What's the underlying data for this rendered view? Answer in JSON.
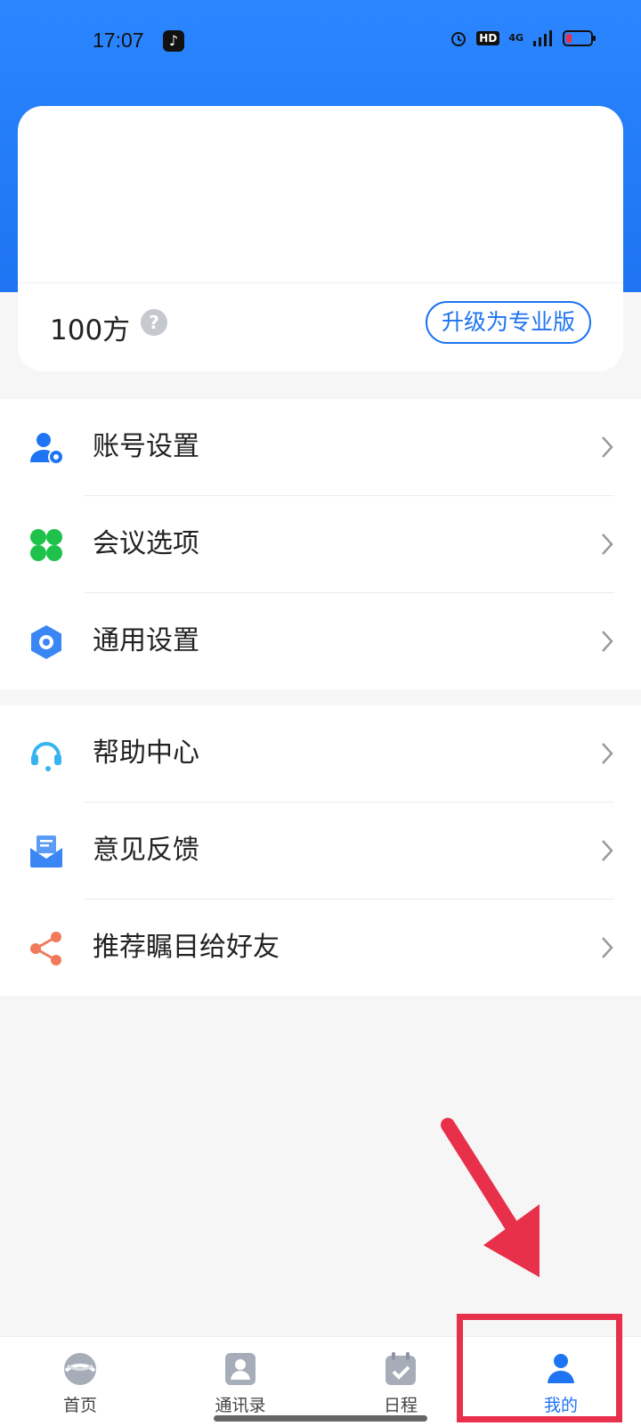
{
  "status": {
    "time": "17:07",
    "hd": "HD",
    "network": "4G"
  },
  "account": {
    "quota": "100方",
    "help_symbol": "?",
    "upgrade_label": "升级为专业版"
  },
  "menu": {
    "group1": [
      {
        "label": "账号设置",
        "icon": "user-gear-icon"
      },
      {
        "label": "会议选项",
        "icon": "clover-icon"
      },
      {
        "label": "通用设置",
        "icon": "hexagon-settings-icon"
      }
    ],
    "group2": [
      {
        "label": "帮助中心",
        "icon": "headset-icon"
      },
      {
        "label": "意见反馈",
        "icon": "mail-feedback-icon"
      },
      {
        "label": "推荐瞩目给好友",
        "icon": "share-icon"
      }
    ]
  },
  "tabs": [
    {
      "label": "首页",
      "icon": "home-swirl-icon",
      "active": false
    },
    {
      "label": "通讯录",
      "icon": "contacts-icon",
      "active": false
    },
    {
      "label": "日程",
      "icon": "calendar-check-icon",
      "active": false
    },
    {
      "label": "我的",
      "icon": "profile-icon",
      "active": true
    }
  ],
  "colors": {
    "primary": "#1e74f2",
    "accent_green": "#1ec24a",
    "accent_orange": "#f07a5a",
    "highlight_red": "#e8304a"
  }
}
